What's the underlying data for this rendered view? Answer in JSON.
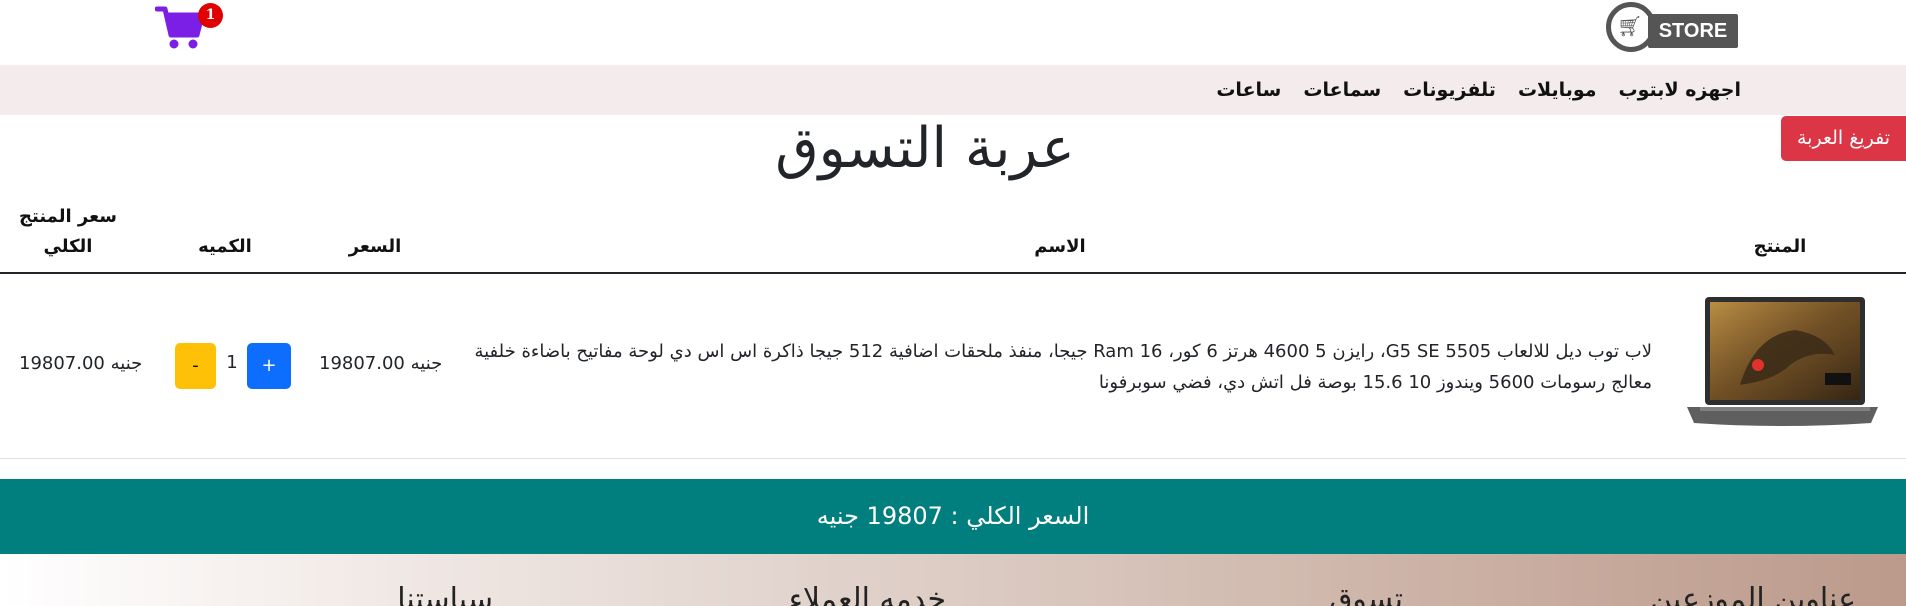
{
  "header": {
    "logo_text": "STORE",
    "cart_count": "1"
  },
  "nav": {
    "items": [
      "اجهزه لابتوب",
      "موبايلات",
      "تلفزيونات",
      "سماعات",
      "ساعات"
    ]
  },
  "cart_page": {
    "clear_label": "تفريغ العربة",
    "title": "عربة التسوق",
    "columns": {
      "product": "المنتج",
      "name": "الاسم",
      "price": "السعر",
      "quantity": "الكميه",
      "total_line1": "سعر المنتج",
      "total_line2": "الكلي"
    },
    "items": [
      {
        "name": "لاب توب ديل للالعاب G5 SE 5505، رايزن 5 4600 هرتز 6 كور، Ram 16 جيجا، منفذ ملحقات اضافية 512 جيجا ذاكرة اس اس دي لوحة مفاتيح باضاءة خلفية معالج رسومات 5600 ويندوز 10 15.6 بوصة فل اتش دي، فضي سوبرفونا",
        "price": "19807.00 جنيه",
        "quantity": "1",
        "plus_label": "+",
        "minus_label": "-",
        "line_total": "19807.00 جنيه"
      }
    ],
    "total_text": "السعر الكلي : 19807 جنيه"
  },
  "footer": {
    "headings": [
      "عناوين الموزعين",
      "تسوق",
      "خدمه العملاء",
      "سياستنا"
    ]
  },
  "colors": {
    "nav_bg": "#f4ecec",
    "danger": "#dc3545",
    "primary": "#0d6efd",
    "warning": "#ffc107",
    "teal": "#017f7f",
    "cart_icon": "#7b1fe6",
    "badge": "#e00000"
  }
}
